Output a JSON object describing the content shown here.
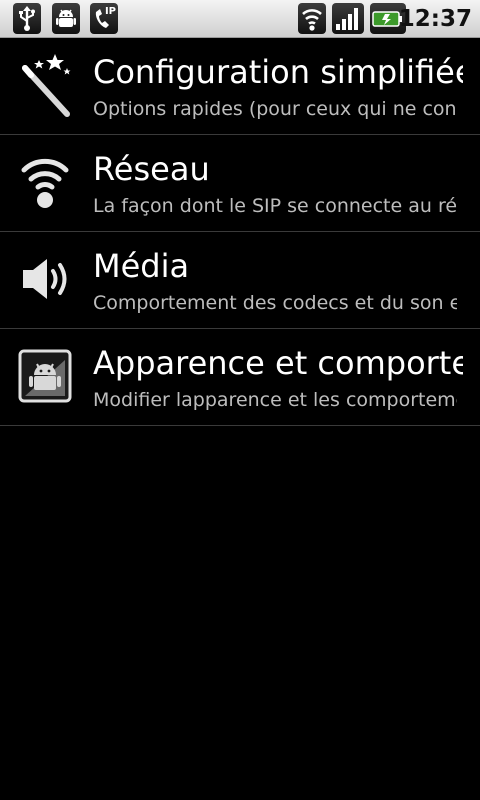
{
  "status_bar": {
    "time": "12:37",
    "left_icons": [
      "usb-icon",
      "android-debug-icon",
      "sip-phone-icon"
    ],
    "sip_badge": "IP",
    "right_icons": [
      "wifi-icon",
      "signal-icon",
      "battery-charging-icon"
    ]
  },
  "settings": [
    {
      "icon": "magic-wand-icon",
      "title": "Configuration simplifiée",
      "subtitle": "Options rapides (pour ceux qui ne conn"
    },
    {
      "icon": "wifi-icon",
      "title": "Réseau",
      "subtitle": "La façon dont le SIP se connecte au rése"
    },
    {
      "icon": "speaker-icon",
      "title": "Média",
      "subtitle": "Comportement des codecs et du son en"
    },
    {
      "icon": "appearance-icon",
      "title": "Apparence et comportem",
      "subtitle": "Modifier lapparence et les comportemen"
    }
  ]
}
